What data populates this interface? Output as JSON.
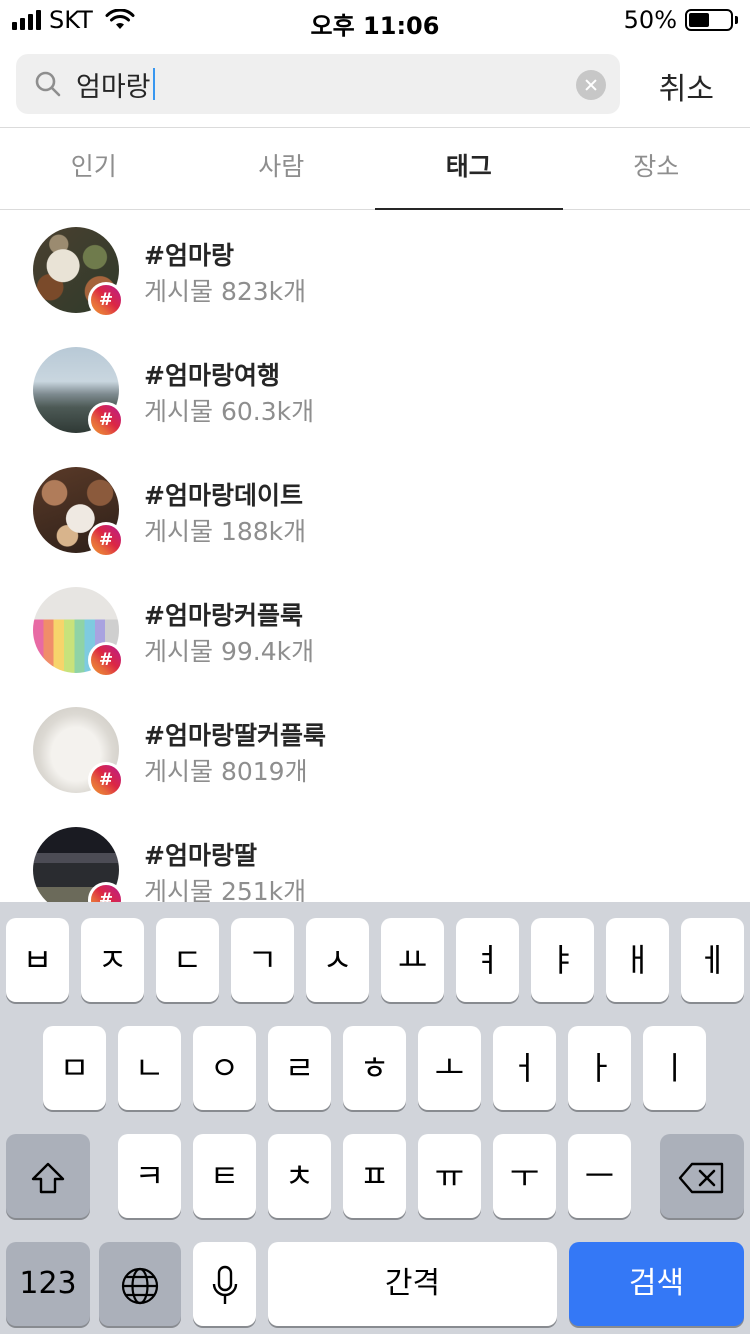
{
  "status_bar": {
    "carrier": "SKT",
    "time": "오후 11:06",
    "battery_percent": "50%",
    "battery_level": 0.5
  },
  "search": {
    "query": "엄마랑",
    "cancel_label": "취소"
  },
  "tabs": [
    {
      "label": "인기",
      "active": false
    },
    {
      "label": "사람",
      "active": false
    },
    {
      "label": "태그",
      "active": true
    },
    {
      "label": "장소",
      "active": false
    }
  ],
  "badge_symbol": "#",
  "results": [
    {
      "tag": "#엄마랑",
      "count": "게시물 823k개"
    },
    {
      "tag": "#엄마랑여행",
      "count": "게시물 60.3k개"
    },
    {
      "tag": "#엄마랑데이트",
      "count": "게시물 188k개"
    },
    {
      "tag": "#엄마랑커플룩",
      "count": "게시물 99.4k개"
    },
    {
      "tag": "#엄마랑딸커플룩",
      "count": "게시물 8019개"
    },
    {
      "tag": "#엄마랑딸",
      "count": "게시물 251k개"
    }
  ],
  "keyboard": {
    "row1": [
      "ㅂ",
      "ㅈ",
      "ㄷ",
      "ㄱ",
      "ㅅ",
      "ㅛ",
      "ㅕ",
      "ㅑ",
      "ㅐ",
      "ㅔ"
    ],
    "row2": [
      "ㅁ",
      "ㄴ",
      "ㅇ",
      "ㄹ",
      "ㅎ",
      "ㅗ",
      "ㅓ",
      "ㅏ",
      "ㅣ"
    ],
    "row3": [
      "ㅋ",
      "ㅌ",
      "ㅊ",
      "ㅍ",
      "ㅠ",
      "ㅜ",
      "ㅡ"
    ],
    "numbers_label": "123",
    "space_label": "간격",
    "search_label": "검색"
  }
}
